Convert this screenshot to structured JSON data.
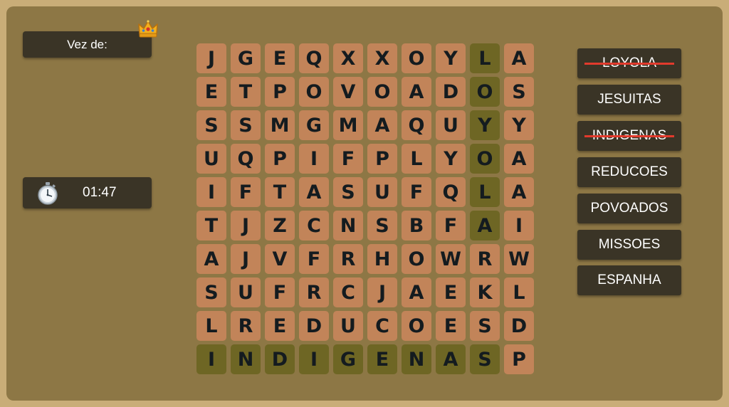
{
  "turn": {
    "label": "Vez de:"
  },
  "timer": {
    "value": "01:47"
  },
  "grid": {
    "rows": [
      [
        "J",
        "G",
        "E",
        "Q",
        "X",
        "X",
        "O",
        "Y",
        "L",
        "A"
      ],
      [
        "E",
        "T",
        "P",
        "O",
        "V",
        "O",
        "A",
        "D",
        "O",
        "S"
      ],
      [
        "S",
        "S",
        "M",
        "G",
        "M",
        "A",
        "Q",
        "U",
        "Y",
        "Y"
      ],
      [
        "U",
        "Q",
        "P",
        "I",
        "F",
        "P",
        "L",
        "Y",
        "O",
        "A"
      ],
      [
        "I",
        "F",
        "T",
        "A",
        "S",
        "U",
        "F",
        "Q",
        "L",
        "A"
      ],
      [
        "T",
        "J",
        "Z",
        "C",
        "N",
        "S",
        "B",
        "F",
        "A",
        "I"
      ],
      [
        "A",
        "J",
        "V",
        "F",
        "R",
        "H",
        "O",
        "W",
        "R",
        "W"
      ],
      [
        "S",
        "U",
        "F",
        "R",
        "C",
        "J",
        "A",
        "E",
        "K",
        "L"
      ],
      [
        "L",
        "R",
        "E",
        "D",
        "U",
        "C",
        "O",
        "E",
        "S",
        "D"
      ],
      [
        "I",
        "N",
        "D",
        "I",
        "G",
        "E",
        "N",
        "A",
        "S",
        "P"
      ]
    ],
    "found_cells": [
      [
        0,
        8
      ],
      [
        1,
        8
      ],
      [
        2,
        8
      ],
      [
        3,
        8
      ],
      [
        4,
        8
      ],
      [
        5,
        8
      ],
      [
        9,
        0
      ],
      [
        9,
        1
      ],
      [
        9,
        2
      ],
      [
        9,
        3
      ],
      [
        9,
        4
      ],
      [
        9,
        5
      ],
      [
        9,
        6
      ],
      [
        9,
        7
      ],
      [
        9,
        8
      ]
    ]
  },
  "words": [
    {
      "text": "LOYOLA",
      "found": true
    },
    {
      "text": "JESUITAS",
      "found": false
    },
    {
      "text": "INDIGENAS",
      "found": true
    },
    {
      "text": "REDUCOES",
      "found": false
    },
    {
      "text": "POVOADOS",
      "found": false
    },
    {
      "text": "MISSOES",
      "found": false
    },
    {
      "text": "ESPANHA",
      "found": false
    }
  ],
  "colors": {
    "background": "#8d7745",
    "cell": "#c28459",
    "found_cell": "#6e6624",
    "panel": "#3a3426",
    "strike": "#e23a2c"
  }
}
